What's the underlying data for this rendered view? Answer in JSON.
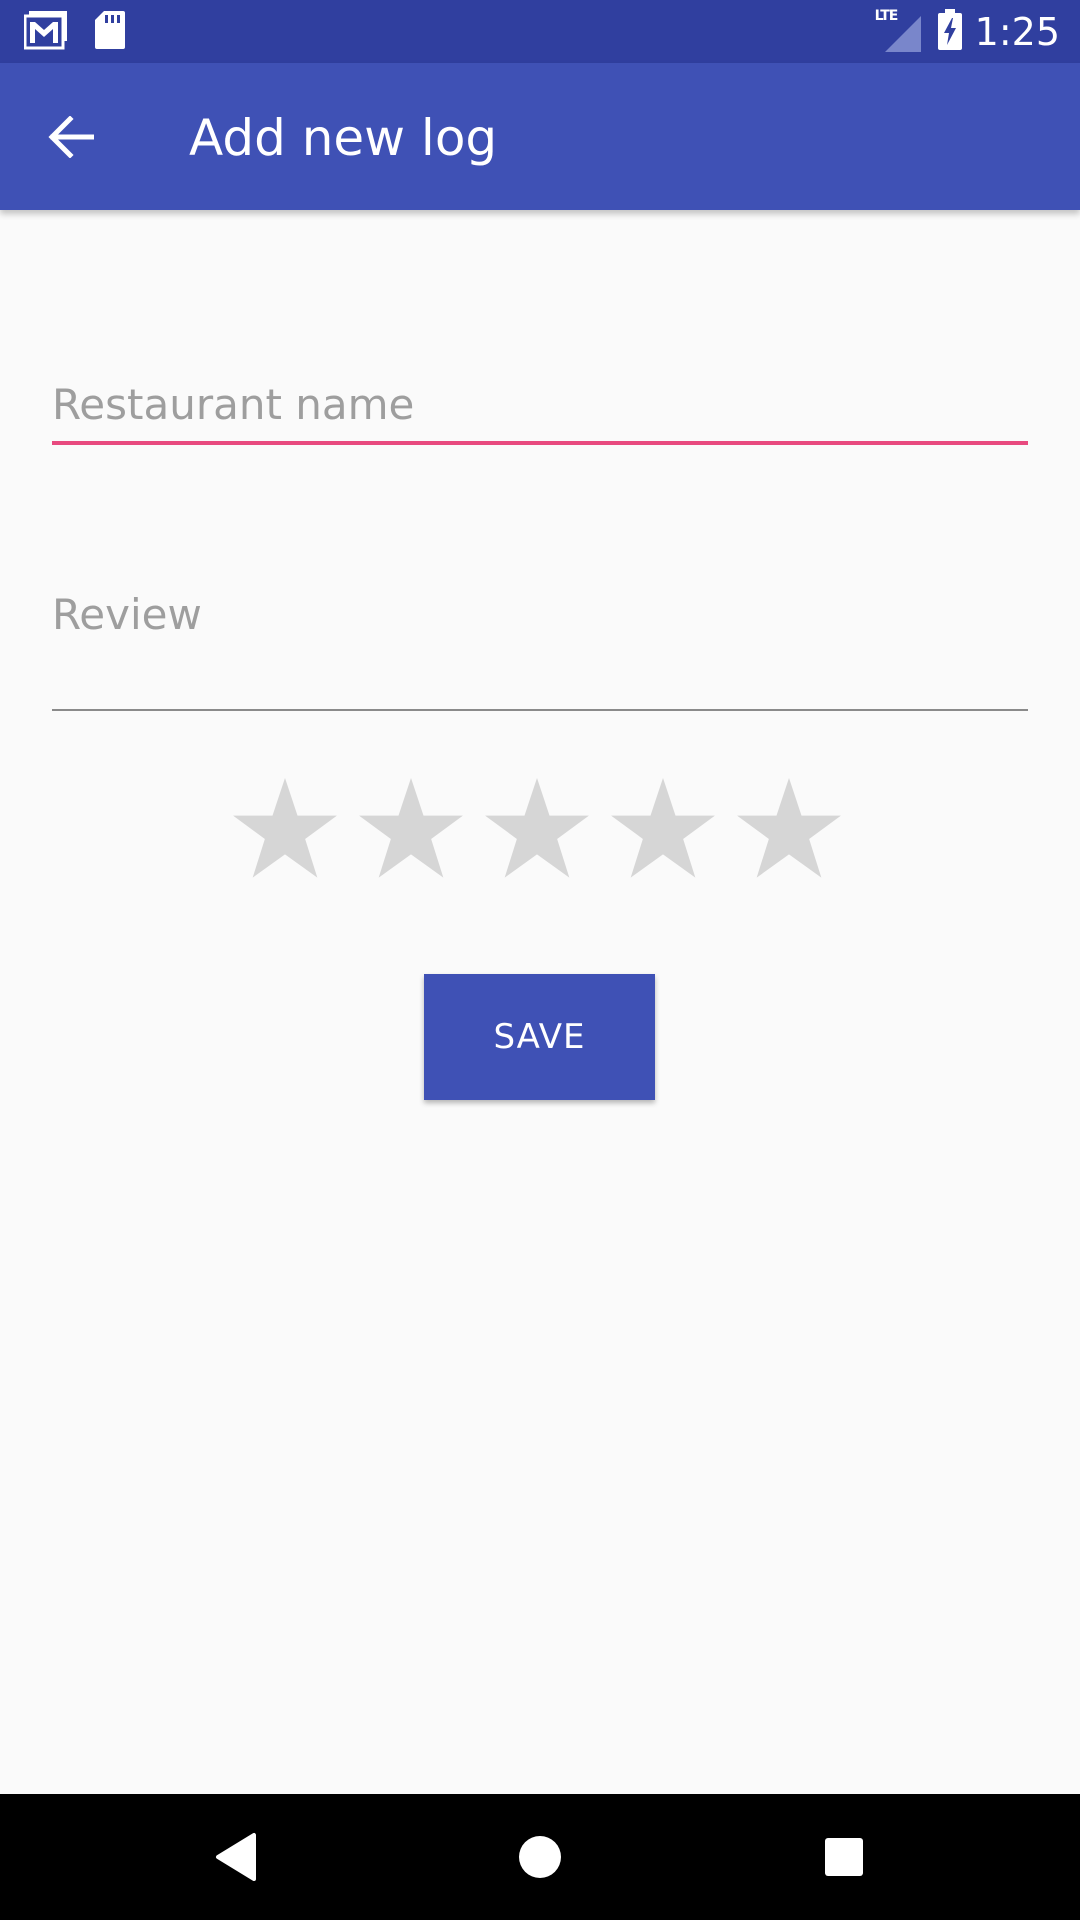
{
  "status_bar": {
    "time": "1:25",
    "network": "LTE",
    "left_icons": [
      "gmail-icon",
      "sd-card-icon"
    ],
    "right_icons": [
      "lte-signal-icon",
      "battery-charging-icon"
    ]
  },
  "app_bar": {
    "title": "Add new log",
    "back_icon": "arrow-back-icon",
    "color": "#3f51b5",
    "status_color": "#303f9f"
  },
  "form": {
    "restaurant_name": {
      "value": "",
      "placeholder": "Restaurant name",
      "accent_color": "#e84a7f"
    },
    "review": {
      "value": "",
      "placeholder": "Review"
    },
    "rating": {
      "stars_max": 5,
      "stars_selected": 0,
      "empty_color": "#d6d6d6"
    },
    "save_label": "SAVE"
  },
  "nav_bar": {
    "buttons": [
      "back-triangle-icon",
      "home-circle-icon",
      "recents-square-icon"
    ]
  }
}
